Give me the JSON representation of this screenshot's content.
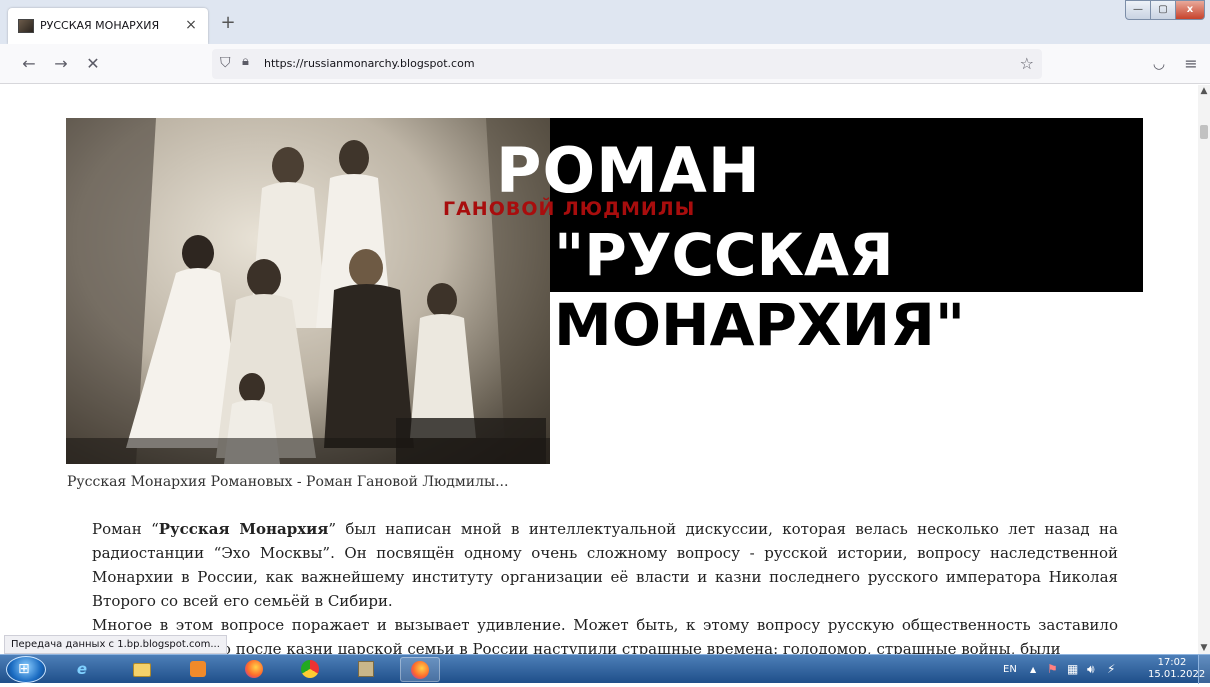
{
  "browser": {
    "tab": {
      "title": "РУССКАЯ МОНАРХИЯ",
      "close": "×"
    },
    "new_tab": "+",
    "window_controls": {
      "minimize": "—",
      "maximize": "▢",
      "close": "x"
    },
    "nav": {
      "back": "←",
      "forward": "→",
      "stop": "✕"
    },
    "url": "https://russianmonarchy.blogspot.com",
    "menu_icons": {
      "pocket": "◡",
      "menu": "≡"
    },
    "status_tip": "Передача данных с 1.bp.blogspot.com..."
  },
  "page": {
    "banner": {
      "line1": "РОМАН",
      "author": "ГАНОВОЙ  ЛЮДМИЛЫ",
      "line2": "\"РУССКАЯ",
      "line3": "МОНАРХИЯ\""
    },
    "caption": "Русская Монархия Романовых - Роман Гановой Людмилы...",
    "article": {
      "p1_before": "Роман “",
      "p1_bold": "Русская Монархия",
      "p1_after": "” был написан мной в интеллектуальной дискуссии, которая велась несколько лет назад на радиостанции “Эхо Москвы”. Он посвящён одному очень сложному вопросу - русской истории, вопросу наследственной Монархии в России, как важнейшему институту организации её власти и казни последнего русского императора Николая Второго со всей его семьёй в Сибири.",
      "p2": "Многое в этом вопросе поражает и вызывает удивление. Может быть, к этому вопросу русскую общественность заставило вернуться то, что после казни царской семьи в России наступили страшные времена: голодомор, страшные войны, были"
    }
  },
  "taskbar": {
    "start": "⊞",
    "apps": [
      "ie-icon",
      "explorer-icon",
      "media-player-icon",
      "firefox-icon",
      "chrome-icon",
      "tool-icon",
      "firefox-active-icon"
    ],
    "tray": {
      "lang": "EN",
      "arrow": "▲"
    },
    "clock": {
      "time": "17:02",
      "date": "15.01.2022"
    }
  }
}
